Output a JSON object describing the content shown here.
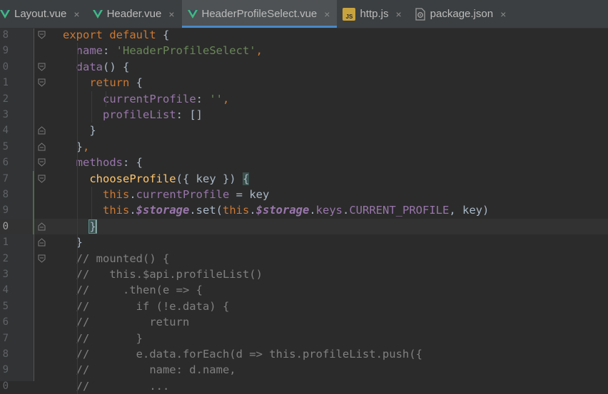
{
  "tabs": [
    {
      "label": "Layout.vue",
      "icon": "vue-icon",
      "active": false
    },
    {
      "label": "Header.vue",
      "icon": "vue-icon",
      "active": false
    },
    {
      "label": "HeaderProfileSelect.vue",
      "icon": "vue-icon",
      "active": true
    },
    {
      "label": "http.js",
      "icon": "js-file-icon",
      "active": false
    },
    {
      "label": "package.json",
      "icon": "package-json-icon",
      "active": false
    }
  ],
  "close_glyph": "×",
  "colors": {
    "keyword": "#cc7832",
    "string": "#6a8759",
    "property": "#9876aa",
    "function": "#ffc66d",
    "comment": "#808080",
    "default": "#a9b7c6",
    "active_tab_underline": "#4a88c7"
  },
  "lines": [
    {
      "num": "8",
      "tokens": [
        {
          "t": "export default ",
          "c": "kw"
        },
        {
          "t": "{",
          "c": "def"
        }
      ]
    },
    {
      "num": "9",
      "tokens": [
        {
          "t": "  ",
          "c": "def"
        },
        {
          "t": "name",
          "c": "prop"
        },
        {
          "t": ": ",
          "c": "def"
        },
        {
          "t": "'HeaderProfileSelect'",
          "c": "str"
        },
        {
          "t": ",",
          "c": "kw"
        }
      ]
    },
    {
      "num": "0",
      "tokens": [
        {
          "t": "  ",
          "c": "def"
        },
        {
          "t": "data",
          "c": "prop"
        },
        {
          "t": "() {",
          "c": "def"
        }
      ]
    },
    {
      "num": "1",
      "tokens": [
        {
          "t": "    ",
          "c": "def"
        },
        {
          "t": "return ",
          "c": "kw"
        },
        {
          "t": "{",
          "c": "def"
        }
      ]
    },
    {
      "num": "2",
      "tokens": [
        {
          "t": "      ",
          "c": "def"
        },
        {
          "t": "currentProfile",
          "c": "prop"
        },
        {
          "t": ": ",
          "c": "def"
        },
        {
          "t": "''",
          "c": "str"
        },
        {
          "t": ",",
          "c": "kw"
        }
      ]
    },
    {
      "num": "3",
      "tokens": [
        {
          "t": "      ",
          "c": "def"
        },
        {
          "t": "profileList",
          "c": "prop"
        },
        {
          "t": ": []",
          "c": "def"
        }
      ]
    },
    {
      "num": "4",
      "tokens": [
        {
          "t": "    }",
          "c": "def"
        }
      ]
    },
    {
      "num": "5",
      "tokens": [
        {
          "t": "  }",
          "c": "def"
        },
        {
          "t": ",",
          "c": "kw"
        }
      ]
    },
    {
      "num": "6",
      "tokens": [
        {
          "t": "  ",
          "c": "def"
        },
        {
          "t": "methods",
          "c": "prop"
        },
        {
          "t": ": {",
          "c": "def"
        }
      ]
    },
    {
      "num": "7",
      "tokens": [
        {
          "t": "    ",
          "c": "def"
        },
        {
          "t": "chooseProfile",
          "c": "fn"
        },
        {
          "t": "({ key }) ",
          "c": "def"
        },
        {
          "t": "{",
          "c": "brace-hl"
        }
      ]
    },
    {
      "num": "8",
      "tokens": [
        {
          "t": "      ",
          "c": "def"
        },
        {
          "t": "this",
          "c": "kw"
        },
        {
          "t": ".",
          "c": "def"
        },
        {
          "t": "currentProfile",
          "c": "prop"
        },
        {
          "t": " = key",
          "c": "def"
        }
      ]
    },
    {
      "num": "9",
      "tokens": [
        {
          "t": "      ",
          "c": "def"
        },
        {
          "t": "this",
          "c": "kw"
        },
        {
          "t": ".",
          "c": "def"
        },
        {
          "t": "$storage",
          "c": "st"
        },
        {
          "t": ".set(",
          "c": "def"
        },
        {
          "t": "this",
          "c": "kw"
        },
        {
          "t": ".",
          "c": "def"
        },
        {
          "t": "$storage",
          "c": "st"
        },
        {
          "t": ".",
          "c": "def"
        },
        {
          "t": "keys",
          "c": "prop"
        },
        {
          "t": ".",
          "c": "def"
        },
        {
          "t": "CURRENT_PROFILE",
          "c": "prop"
        },
        {
          "t": ", key)",
          "c": "def"
        }
      ]
    },
    {
      "num": "0",
      "current": true,
      "tokens": [
        {
          "t": "    ",
          "c": "def"
        },
        {
          "t": "}",
          "c": "brace-hl2"
        }
      ]
    },
    {
      "num": "1",
      "tokens": [
        {
          "t": "  }",
          "c": "def"
        }
      ]
    },
    {
      "num": "2",
      "tokens": [
        {
          "t": "  // mounted() {",
          "c": "cm"
        }
      ]
    },
    {
      "num": "3",
      "tokens": [
        {
          "t": "  //   this.$api.profileList()",
          "c": "cm"
        }
      ]
    },
    {
      "num": "4",
      "tokens": [
        {
          "t": "  //     .then(e => {",
          "c": "cm"
        }
      ]
    },
    {
      "num": "5",
      "tokens": [
        {
          "t": "  //       if (!e.data) {",
          "c": "cm"
        }
      ]
    },
    {
      "num": "6",
      "tokens": [
        {
          "t": "  //         return",
          "c": "cm"
        }
      ]
    },
    {
      "num": "7",
      "tokens": [
        {
          "t": "  //       }",
          "c": "cm"
        }
      ]
    },
    {
      "num": "8",
      "tokens": [
        {
          "t": "  //       e.data.forEach(d => this.profileList.push({",
          "c": "cm"
        }
      ]
    },
    {
      "num": "9",
      "tokens": [
        {
          "t": "  //         name: d.name,",
          "c": "cm"
        }
      ]
    },
    {
      "num": "0",
      "tokens": [
        {
          "t": "  //         ...",
          "c": "cm"
        }
      ]
    }
  ]
}
